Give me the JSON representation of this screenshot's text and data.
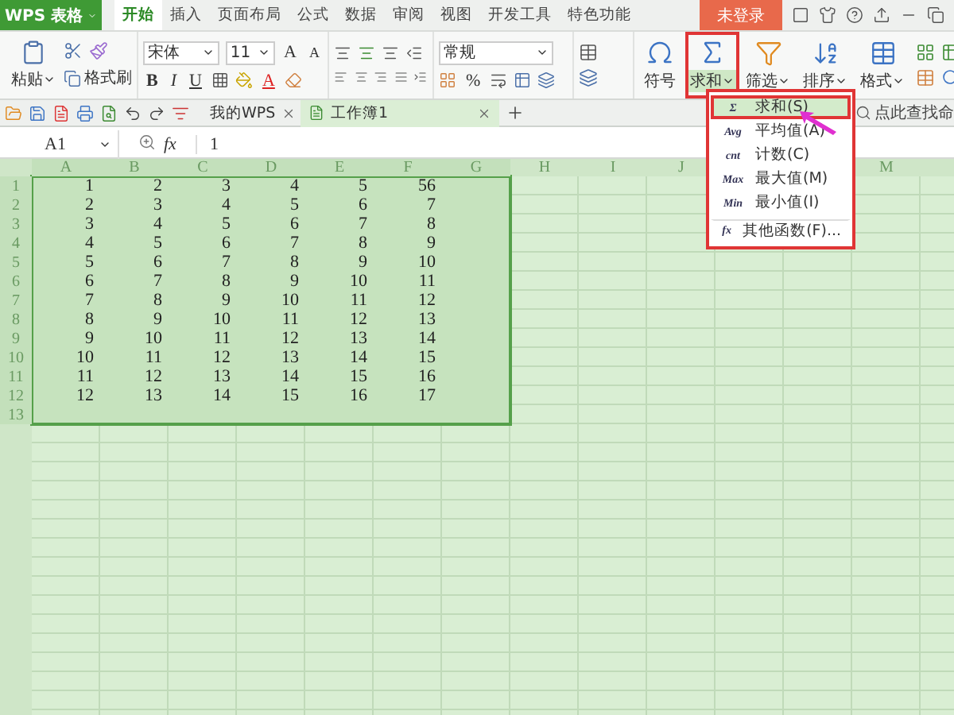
{
  "app_button": {
    "label": "WPS 表格"
  },
  "tabs": [
    {
      "label": "开始",
      "selected": true
    },
    {
      "label": "插入",
      "selected": false
    },
    {
      "label": "页面布局",
      "selected": false
    },
    {
      "label": "公式",
      "selected": false
    },
    {
      "label": "数据",
      "selected": false
    },
    {
      "label": "审阅",
      "selected": false
    },
    {
      "label": "视图",
      "selected": false
    },
    {
      "label": "开发工具",
      "selected": false
    },
    {
      "label": "特色功能",
      "selected": false
    }
  ],
  "login": "未登录",
  "ribbon": {
    "paste": "粘贴",
    "format_painter": "格式刷",
    "font_name": "宋体",
    "font_size": "11",
    "grow_font": "A",
    "shrink_font": "A",
    "font_styles": [
      "B",
      "I",
      "U"
    ],
    "font_color": "A",
    "number_format": "常规",
    "percent": "%",
    "symbol": "符号",
    "sum": {
      "label": "求和",
      "highlighted": true
    },
    "filter": "筛选",
    "sort": "排序",
    "format": "格式"
  },
  "doc_tabs": [
    {
      "label": "我的WPS",
      "selected": false,
      "kind": "home"
    },
    {
      "label": "工作簿1",
      "selected": true,
      "kind": "workbook"
    }
  ],
  "search": {
    "placeholder": "点此查找命"
  },
  "formula_bar": {
    "name_box": "A1",
    "fx": "fx",
    "value": "1"
  },
  "sheet": {
    "columns": [
      {
        "label": "A",
        "selected": true
      },
      {
        "label": "B",
        "selected": true
      },
      {
        "label": "C",
        "selected": true
      },
      {
        "label": "D",
        "selected": true
      },
      {
        "label": "E",
        "selected": true
      },
      {
        "label": "F",
        "selected": true
      },
      {
        "label": "G",
        "selected": true
      },
      {
        "label": "H",
        "selected": false
      },
      {
        "label": "I",
        "selected": false
      },
      {
        "label": "J",
        "selected": false
      }
    ],
    "columns_after_menu": [
      {
        "label": "M",
        "selected": false
      }
    ],
    "rows": [
      {
        "number": "1",
        "selected": true,
        "cells": [
          "1",
          "2",
          "3",
          "4",
          "5",
          "56"
        ]
      },
      {
        "number": "2",
        "selected": true,
        "cells": [
          "2",
          "3",
          "4",
          "5",
          "6",
          "7"
        ]
      },
      {
        "number": "3",
        "selected": true,
        "cells": [
          "3",
          "4",
          "5",
          "6",
          "7",
          "8"
        ]
      },
      {
        "number": "4",
        "selected": true,
        "cells": [
          "4",
          "5",
          "6",
          "7",
          "8",
          "9"
        ]
      },
      {
        "number": "5",
        "selected": true,
        "cells": [
          "5",
          "6",
          "7",
          "8",
          "9",
          "10"
        ]
      },
      {
        "number": "6",
        "selected": true,
        "cells": [
          "6",
          "7",
          "8",
          "9",
          "10",
          "11"
        ]
      },
      {
        "number": "7",
        "selected": true,
        "cells": [
          "7",
          "8",
          "9",
          "10",
          "11",
          "12"
        ]
      },
      {
        "number": "8",
        "selected": true,
        "cells": [
          "8",
          "9",
          "10",
          "11",
          "12",
          "13"
        ]
      },
      {
        "number": "9",
        "selected": true,
        "cells": [
          "9",
          "10",
          "11",
          "12",
          "13",
          "14"
        ]
      },
      {
        "number": "10",
        "selected": true,
        "cells": [
          "10",
          "11",
          "12",
          "13",
          "14",
          "15"
        ]
      },
      {
        "number": "11",
        "selected": true,
        "cells": [
          "11",
          "12",
          "13",
          "14",
          "15",
          "16"
        ]
      },
      {
        "number": "12",
        "selected": true,
        "cells": [
          "12",
          "13",
          "14",
          "15",
          "16",
          "17"
        ]
      },
      {
        "number": "13",
        "selected": true,
        "cells": []
      }
    ]
  },
  "sum_menu": {
    "highlighted": true,
    "items": [
      {
        "icon": "Σ",
        "label": "求和(S)",
        "selected": true,
        "divider_before": false
      },
      {
        "icon": "Avg",
        "label": "平均值(A)",
        "selected": false,
        "divider_before": false
      },
      {
        "icon": "cnt",
        "label": "计数(C)",
        "selected": false,
        "divider_before": false
      },
      {
        "icon": "Max",
        "label": "最大值(M)",
        "selected": false,
        "divider_before": false
      },
      {
        "icon": "Min",
        "label": "最小值(I)",
        "selected": false,
        "divider_before": false
      },
      {
        "icon": "fx",
        "label": "其他函数(F)...",
        "selected": false,
        "divider_before": true
      }
    ]
  }
}
